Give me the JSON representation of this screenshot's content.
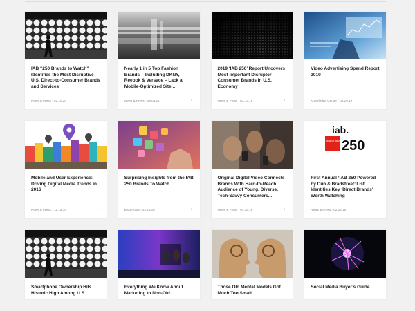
{
  "cards": [
    {
      "title": "IAB “250 Brands to Watch” Identifies the Most Disruptive U.S. Direct-to-Consumer Brands and Services",
      "meta": "News & Press · 02.10.20",
      "image": "city-pedestrian-lights"
    },
    {
      "title": "Nearly 1 in 5 Top Fashion Brands – Including DKNY, Reebok & Versace – Lack a Mobile-Optimized Site...",
      "meta": "News & Press · 09.03.14",
      "image": "blurred-street"
    },
    {
      "title": "2019 ‘IAB 250’ Report Uncovers Most Important Disruptor Consumer Brands in U.S. Economy",
      "meta": "News & Press · 02.13.19",
      "image": "dark-dots"
    },
    {
      "title": "Video Advertising Spend Report 2019",
      "meta": "Knowledge Center · 04.29.19",
      "image": "blue-data-screen"
    },
    {
      "title": "Mobile and User Experience: Driving Digital Media Trends in 2016",
      "meta": "News & Press · 12.15.15",
      "image": "colorful-town-pins"
    },
    {
      "title": "Surprising Insights from the IAB 250 Brands To Watch",
      "meta": "Blog Posts · 02.28.19",
      "image": "app-icons-hand"
    },
    {
      "title": "Original Digital Video Connects Brands With Hard-to-Reach Audience of Young, Diverse, Tech-Savvy Consumers...",
      "meta": "News & Press · 04.26.18",
      "image": "people-phones"
    },
    {
      "title": "First Annual ‘IAB 250 Powered by Dun & Bradstreet’ List Identifies Key ‘Direct Brands’ Worth Watching",
      "meta": "News & Press · 02.12.18",
      "image": "iab-250-logo"
    },
    {
      "title": "Smartphone Ownership Hits Historic High Among U.S....",
      "meta": "",
      "image": "city-pedestrian-lights"
    },
    {
      "title": "Everything We Know About Marketing to Non-Old...",
      "meta": "",
      "image": "panel-stage"
    },
    {
      "title": "Those Old Mental Models Got Much Too Small...",
      "meta": "",
      "image": "wooden-heads-gears"
    },
    {
      "title": "Social Media Buyer’s Guide",
      "meta": "",
      "image": "plasma-ball"
    }
  ],
  "logo": {
    "iab": "iab.",
    "num": "250",
    "sub": "DIRECT BRANDS TO WATCH"
  },
  "colors": {
    "accent": "#e8492f",
    "iab_red": "#e2231a"
  },
  "arrow_glyph": "→"
}
